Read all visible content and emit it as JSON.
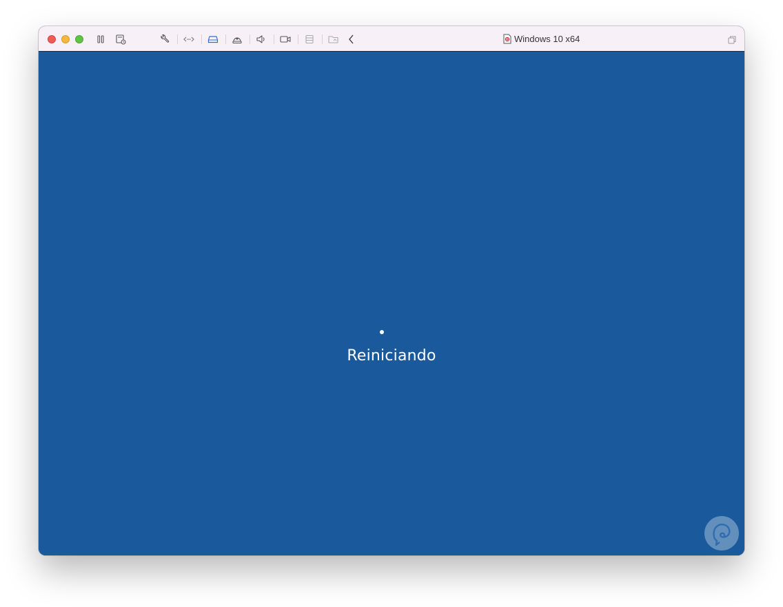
{
  "window": {
    "title": "Windows 10 x64"
  },
  "toolbar": {
    "buttons": [
      {
        "name": "pause",
        "icon": "pause-icon"
      },
      {
        "name": "snapshot",
        "icon": "snapshot-icon"
      },
      {
        "name": "settings",
        "icon": "wrench-icon"
      },
      {
        "name": "network",
        "icon": "network-arrows-icon"
      },
      {
        "name": "disk",
        "icon": "hard-disk-icon"
      },
      {
        "name": "camera-webcam",
        "icon": "webcam-icon"
      },
      {
        "name": "sound",
        "icon": "speaker-icon"
      },
      {
        "name": "video",
        "icon": "video-camera-icon"
      },
      {
        "name": "usb",
        "icon": "storage-icon"
      },
      {
        "name": "shared-folders",
        "icon": "folder-icon"
      },
      {
        "name": "back",
        "icon": "chevron-left-icon"
      }
    ]
  },
  "guest": {
    "status_text": "Reiniciando",
    "background_color": "#1a5a9c"
  },
  "colors": {
    "titlebar": "#f8f0f7",
    "accent": "#2a6fd6"
  }
}
